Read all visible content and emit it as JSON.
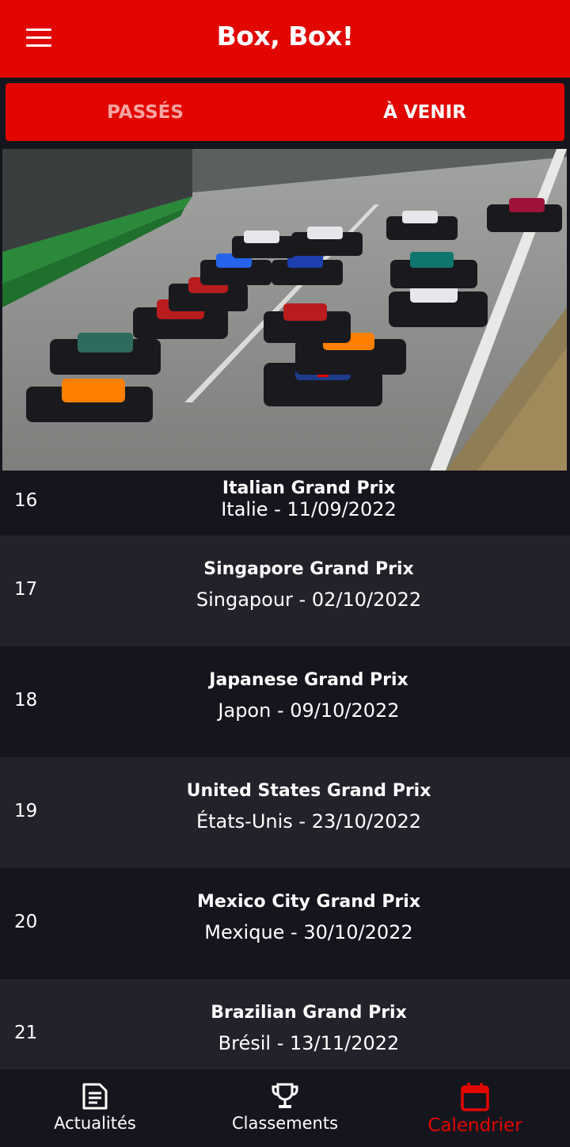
{
  "app": {
    "title": "Box, Box!"
  },
  "tabs": {
    "past": "PASSÉS",
    "upcoming": "À VENIR"
  },
  "races": [
    {
      "round": "16",
      "name": "Italian Grand Prix",
      "detail": "Italie - 11/09/2022"
    },
    {
      "round": "17",
      "name": "Singapore Grand Prix",
      "detail": "Singapour - 02/10/2022"
    },
    {
      "round": "18",
      "name": "Japanese Grand Prix",
      "detail": "Japon - 09/10/2022"
    },
    {
      "round": "19",
      "name": "United States Grand Prix",
      "detail": "États-Unis - 23/10/2022"
    },
    {
      "round": "20",
      "name": "Mexico City Grand Prix",
      "detail": "Mexique - 30/10/2022"
    },
    {
      "round": "21",
      "name": "Brazilian Grand Prix",
      "detail": "Brésil - 13/11/2022"
    }
  ],
  "nav": {
    "news": "Actualités",
    "standings": "Classements",
    "calendar": "Calendrier"
  },
  "colors": {
    "brand": "#e10600",
    "background": "#15151e",
    "row_alt": "#22222b"
  },
  "icons": {
    "menu": "menu-icon",
    "news": "article-icon",
    "standings": "trophy-icon",
    "calendar": "calendar-icon"
  }
}
